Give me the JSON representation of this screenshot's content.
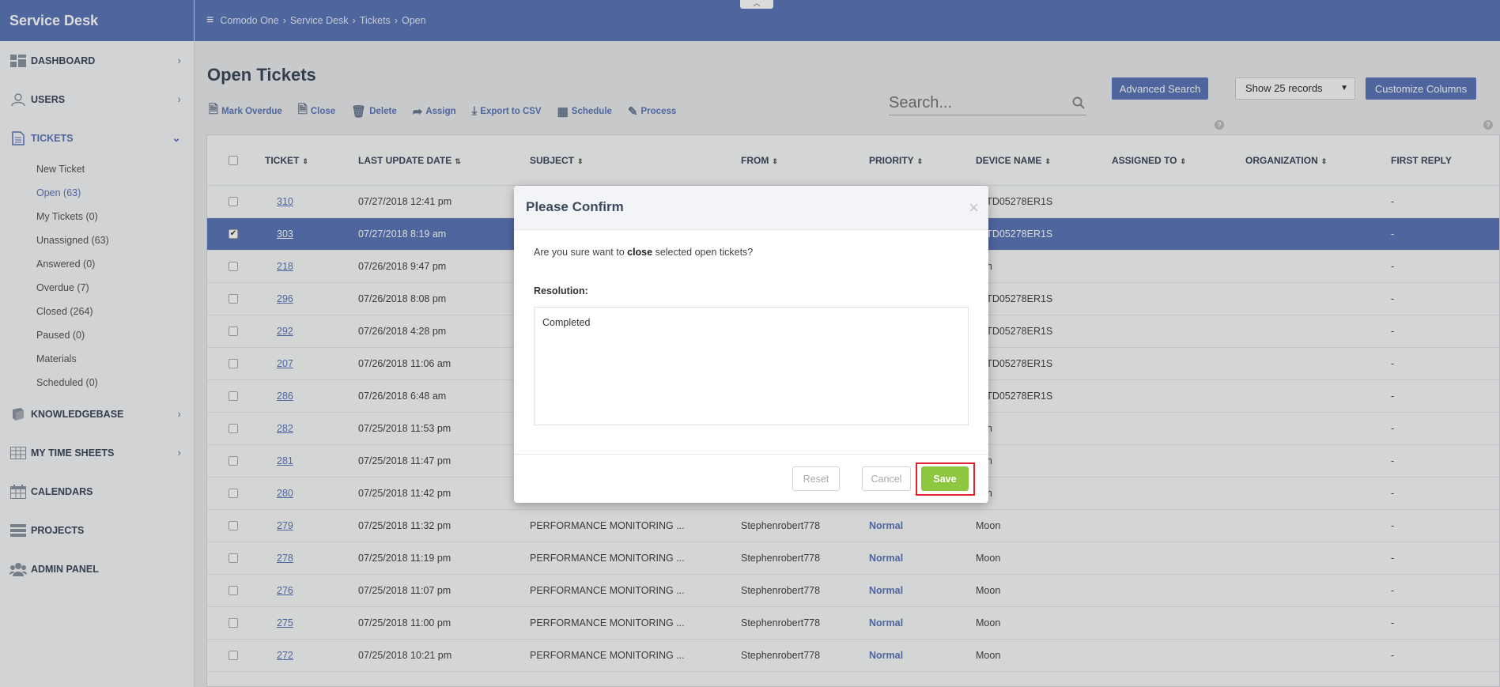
{
  "brand": "Service Desk",
  "breadcrumb": [
    "Comodo One",
    "Service Desk",
    "Tickets",
    "Open"
  ],
  "sidebar": {
    "items": [
      {
        "label": "DASHBOARD",
        "icon": "dashboard-icon"
      },
      {
        "label": "USERS",
        "icon": "user-icon"
      },
      {
        "label": "TICKETS",
        "icon": "ticket-icon"
      },
      {
        "label": "KNOWLEDGEBASE",
        "icon": "book-icon"
      },
      {
        "label": "MY TIME SHEETS",
        "icon": "grid-icon"
      },
      {
        "label": "CALENDARS",
        "icon": "calendar-icon"
      },
      {
        "label": "PROJECTS",
        "icon": "projects-icon"
      },
      {
        "label": "ADMIN PANEL",
        "icon": "group-icon"
      }
    ],
    "tickets_sub": [
      "New Ticket",
      "Open (63)",
      "My Tickets (0)",
      "Unassigned (63)",
      "Answered (0)",
      "Overdue (7)",
      "Closed (264)",
      "Paused (0)",
      "Materials",
      "Scheduled (0)"
    ]
  },
  "page_title": "Open Tickets",
  "toolbar": {
    "mark_overdue": "Mark Overdue",
    "close": "Close",
    "delete": "Delete",
    "assign": "Assign",
    "export": "Export to CSV",
    "schedule": "Schedule",
    "process": "Process"
  },
  "search": {
    "placeholder": "Search..."
  },
  "advanced_search": "Advanced Search",
  "records_select": "Show 25 records",
  "customize_columns": "Customize Columns",
  "table": {
    "headers": [
      "TICKET",
      "LAST UPDATE DATE",
      "SUBJECT",
      "FROM",
      "PRIORITY",
      "DEVICE NAME",
      "ASSIGNED TO",
      "ORGANIZATION",
      "FIRST REPLY"
    ],
    "rows": [
      {
        "ticket": "310",
        "date": "07/27/2018 12:41 pm",
        "subject": "",
        "from": "",
        "priority": "",
        "device": "N-TD05278ER1S",
        "reply": "-",
        "checked": false
      },
      {
        "ticket": "303",
        "date": "07/27/2018 8:19 am",
        "subject": "",
        "from": "",
        "priority": "",
        "device": "N-TD05278ER1S",
        "reply": "-",
        "checked": true
      },
      {
        "ticket": "218",
        "date": "07/26/2018 9:47 pm",
        "subject": "",
        "from": "",
        "priority": "",
        "device": "oon",
        "reply": "-",
        "checked": false
      },
      {
        "ticket": "296",
        "date": "07/26/2018 8:08 pm",
        "subject": "",
        "from": "",
        "priority": "",
        "device": "N-TD05278ER1S",
        "reply": "-",
        "checked": false
      },
      {
        "ticket": "292",
        "date": "07/26/2018 4:28 pm",
        "subject": "",
        "from": "",
        "priority": "",
        "device": "N-TD05278ER1S",
        "reply": "-",
        "checked": false
      },
      {
        "ticket": "207",
        "date": "07/26/2018 11:06 am",
        "subject": "",
        "from": "",
        "priority": "",
        "device": "N-TD05278ER1S",
        "reply": "-",
        "checked": false
      },
      {
        "ticket": "286",
        "date": "07/26/2018 6:48 am",
        "subject": "",
        "from": "",
        "priority": "",
        "device": "N-TD05278ER1S",
        "reply": "-",
        "checked": false
      },
      {
        "ticket": "282",
        "date": "07/25/2018 11:53 pm",
        "subject": "",
        "from": "",
        "priority": "",
        "device": "oon",
        "reply": "-",
        "checked": false
      },
      {
        "ticket": "281",
        "date": "07/25/2018 11:47 pm",
        "subject": "",
        "from": "",
        "priority": "",
        "device": "oon",
        "reply": "-",
        "checked": false
      },
      {
        "ticket": "280",
        "date": "07/25/2018 11:42 pm",
        "subject": "",
        "from": "",
        "priority": "",
        "device": "oon",
        "reply": "-",
        "checked": false
      },
      {
        "ticket": "279",
        "date": "07/25/2018 11:32 pm",
        "subject": "PERFORMANCE MONITORING ...",
        "from": "Stephenrobert778",
        "priority": "Normal",
        "device": "Moon",
        "reply": "-",
        "checked": false
      },
      {
        "ticket": "278",
        "date": "07/25/2018 11:19 pm",
        "subject": "PERFORMANCE MONITORING ...",
        "from": "Stephenrobert778",
        "priority": "Normal",
        "device": "Moon",
        "reply": "-",
        "checked": false
      },
      {
        "ticket": "276",
        "date": "07/25/2018 11:07 pm",
        "subject": "PERFORMANCE MONITORING ...",
        "from": "Stephenrobert778",
        "priority": "Normal",
        "device": "Moon",
        "reply": "-",
        "checked": false
      },
      {
        "ticket": "275",
        "date": "07/25/2018 11:00 pm",
        "subject": "PERFORMANCE MONITORING ...",
        "from": "Stephenrobert778",
        "priority": "Normal",
        "device": "Moon",
        "reply": "-",
        "checked": false
      },
      {
        "ticket": "272",
        "date": "07/25/2018 10:21 pm",
        "subject": "PERFORMANCE MONITORING ...",
        "from": "Stephenrobert778",
        "priority": "Normal",
        "device": "Moon",
        "reply": "-",
        "checked": false
      }
    ]
  },
  "modal": {
    "title": "Please Confirm",
    "close_glyph": "×",
    "question_pre": "Are you sure want to ",
    "question_bold": "close",
    "question_post": " selected open tickets?",
    "resolution_label": "Resolution:",
    "resolution_value": "Completed",
    "reset": "Reset",
    "cancel": "Cancel",
    "save": "Save"
  },
  "colors": {
    "brand": "#5b76b8",
    "save": "#8dc63f",
    "highlight": "#e0242f"
  }
}
